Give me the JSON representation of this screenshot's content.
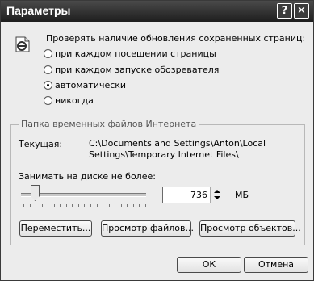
{
  "window": {
    "title": "Параметры",
    "help_glyph": "?",
    "close_glyph": "✕"
  },
  "check_new": {
    "heading": "Проверять наличие обновления сохраненных страниц:",
    "options": [
      {
        "label": "при каждом посещении страницы",
        "checked": false
      },
      {
        "label": "при каждом запуске обозревателя",
        "checked": false
      },
      {
        "label": "автоматически",
        "checked": true
      },
      {
        "label": "никогда",
        "checked": false
      }
    ]
  },
  "temp_folder": {
    "group_title": "Папка временных файлов Интернета",
    "current_label": "Текущая:",
    "current_path_line1": "C:\\Documents and Settings\\Anton\\Local",
    "current_path_line2": "Settings\\Temporary Internet Files\\",
    "disk_label": "Занимать на диске не более:",
    "disk_value": "736",
    "disk_unit": "МБ"
  },
  "buttons": {
    "move": "Переместить...",
    "view_files": "Просмотр файлов...",
    "view_objects": "Просмотр объектов...",
    "ok": "ОК",
    "cancel": "Отмена"
  }
}
